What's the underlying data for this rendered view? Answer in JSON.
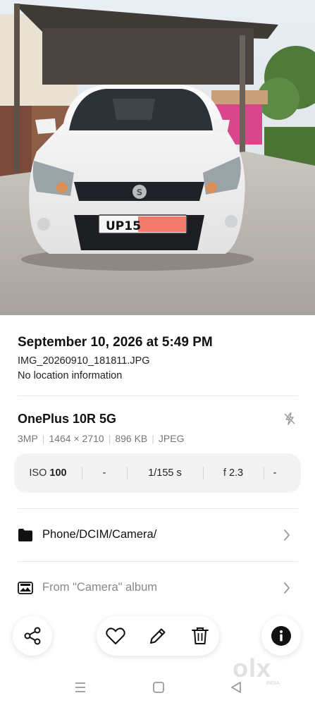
{
  "photo": {
    "plate_text": "UP15",
    "brand_logo": "suzuki-logo"
  },
  "info": {
    "datetime": "September 10, 2026 at 5:49 PM",
    "filename": "IMG_20260910_181811.JPG",
    "location": "No location information"
  },
  "device": {
    "name": "OnePlus 10R 5G",
    "specs": [
      "3MP",
      "1464 × 2710",
      "896 KB",
      "JPEG"
    ],
    "flash_icon": "flash-off-icon"
  },
  "exif": {
    "iso_label": "ISO",
    "iso_value": "100",
    "focal": "-",
    "shutter": "1/155 s",
    "aperture_label": "f",
    "aperture_value": "2.3",
    "exposure": "-"
  },
  "path": {
    "icon": "folder-icon",
    "text": "Phone/DCIM/Camera/"
  },
  "album": {
    "icon": "album-icon",
    "text": "From \"Camera\" album"
  },
  "actions": {
    "share": "share-icon",
    "favorite": "heart-icon",
    "edit": "pencil-icon",
    "delete": "trash-icon",
    "info": "info-icon"
  },
  "watermark": {
    "text": "olx",
    "sub": "INDIA"
  },
  "colors": {
    "background": "#ffffff",
    "panel": "#f3f3f3",
    "info_button": "#111111",
    "plate_redaction": "#f27a6b"
  }
}
